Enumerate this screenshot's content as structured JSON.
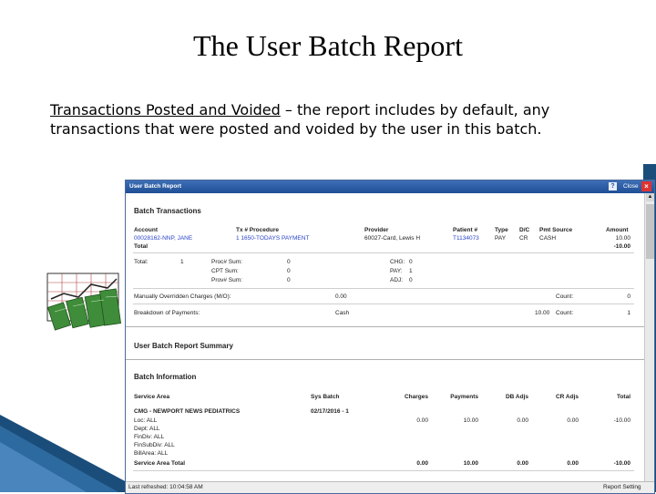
{
  "slide": {
    "title": "The User Batch Report",
    "term": "Transactions Posted and Voided",
    "description": " – the report includes by default, any transactions that were posted and voided by the user in this batch."
  },
  "window": {
    "title": "User Batch Report",
    "help": "?",
    "close_label": "Close",
    "close_x": "×",
    "status_left": "Last refreshed: 10:04:58 AM",
    "status_right": "Report Setting"
  },
  "batch_transactions": {
    "heading": "Batch Transactions",
    "headers": {
      "account": "Account",
      "tx": "Tx # Procedure",
      "provider": "Provider",
      "patient": "Patient #",
      "type": "Type",
      "dc": "D/C",
      "pmt_source": "Pmt Source",
      "amount": "Amount"
    },
    "row": {
      "account": "00028162-NNP, JANE",
      "tx": "1 1650-TODAYS PAYMENT",
      "provider": "60027-Card, Lewis H",
      "patient": "T1134073",
      "type": "PAY",
      "dc": "CR",
      "pmt_source": "CASH",
      "amount": "10.00"
    },
    "total_label": "Total",
    "total_amount": "-10.00",
    "sum_total_label": "Total:",
    "sum_total_value": "1",
    "sums": [
      {
        "label": "Proc# Sum:",
        "value": "0"
      },
      {
        "label": "CPT Sum:",
        "value": "0"
      },
      {
        "label": "Prov# Sum:",
        "value": "0"
      }
    ],
    "codes": [
      {
        "label": "CHG:",
        "value": "0"
      },
      {
        "label": "PAY:",
        "value": "1"
      },
      {
        "label": "ADJ:",
        "value": "0"
      }
    ],
    "override_label": "Manually Overridden Charges (M/O):",
    "override_value": "0.00",
    "override_count_label": "Count:",
    "override_count": "0",
    "breakdown_label": "Breakdown of Payments:",
    "breakdown_type": "Cash",
    "breakdown_amount": "10.00",
    "breakdown_count_label": "Count:",
    "breakdown_count": "1"
  },
  "summary": {
    "heading": "User Batch Report Summary",
    "batch_info_heading": "Batch Information",
    "headers": {
      "service_area": "Service Area",
      "sys_batch": "Sys Batch",
      "charges": "Charges",
      "payments": "Payments",
      "db_adjs": "DB Adjs",
      "cr_adjs": "CR Adjs",
      "total": "Total"
    },
    "row": {
      "service_area": "CMG - NEWPORT NEWS PEDIATRICS",
      "sys_batch": "02/17/2016 - 1",
      "charges": "0.00",
      "payments": "10.00",
      "db_adjs": "0.00",
      "cr_adjs": "0.00",
      "total": "-10.00"
    },
    "filters": [
      "Loc: ALL",
      "Dept: ALL",
      "FinDiv: ALL",
      "FinSubDiv: ALL",
      "BillArea: ALL"
    ],
    "area_total": {
      "label": "Service Area Total",
      "charges": "0.00",
      "payments": "10.00",
      "db_adjs": "0.00",
      "cr_adjs": "0.00",
      "total": "-10.00"
    }
  }
}
